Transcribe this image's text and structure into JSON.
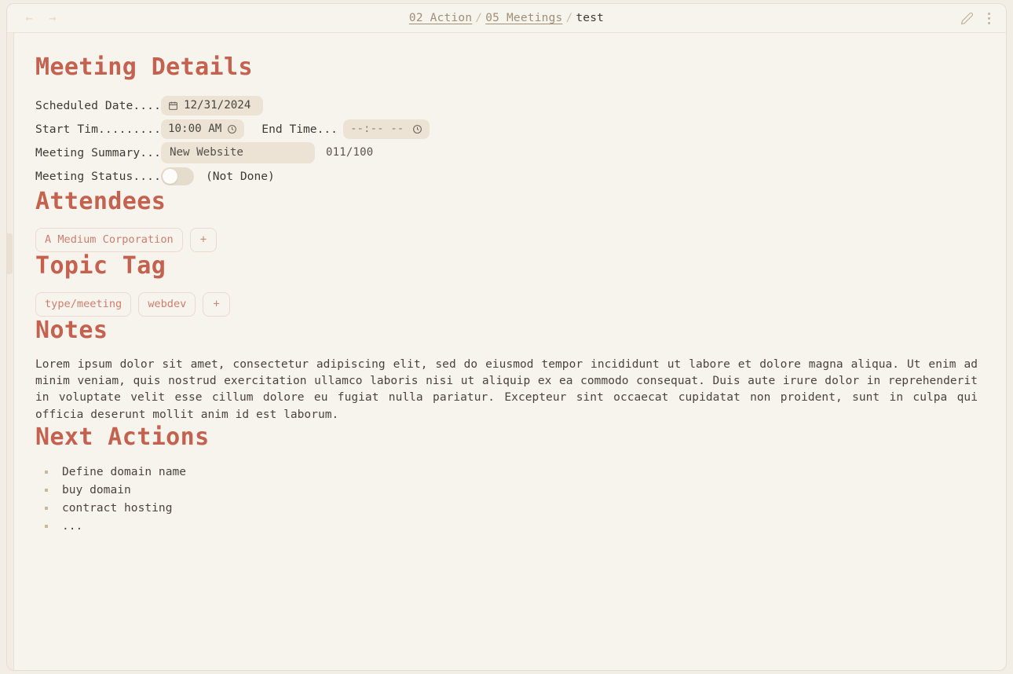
{
  "titlebar": {
    "back_icon": "arrow-left-icon",
    "forward_icon": "arrow-right-icon",
    "back_glyph": "←",
    "forward_glyph": "→",
    "breadcrumb": [
      {
        "label": "02 Action",
        "link": true
      },
      {
        "label": "05 Meetings",
        "link": true
      },
      {
        "label": "test",
        "link": false
      }
    ],
    "separator": "/",
    "edit_icon": "pencil-icon",
    "menu_icon": "kebab-menu-icon"
  },
  "sections": {
    "meeting_details": "Meeting Details",
    "attendees": "Attendees",
    "topic_tag": "Topic Tag",
    "notes": "Notes",
    "next_actions": "Next Actions"
  },
  "details": {
    "scheduled_date": {
      "label": "Scheduled Date....",
      "value": "12/31/2024",
      "icon": "calendar-icon"
    },
    "start_time": {
      "label": "Start Tim.........",
      "value": "10:00 AM",
      "icon": "clock-icon"
    },
    "end_time": {
      "label": "End Time...",
      "value": "--:-- --",
      "icon": "clock-icon"
    },
    "summary": {
      "label": "Meeting Summary...",
      "value": "New Website",
      "counter": "011/100"
    },
    "status": {
      "label": "Meeting Status....",
      "toggle_on": false,
      "note": "(Not Done)"
    }
  },
  "attendees": {
    "items": [
      "A Medium Corporation"
    ],
    "add_label": "+"
  },
  "topic_tags": {
    "items": [
      "type/meeting",
      "webdev"
    ],
    "add_label": "+"
  },
  "notes_body": "Lorem ipsum dolor sit amet, consectetur adipiscing elit, sed do eiusmod tempor incididunt ut labore et dolore magna aliqua. Ut enim ad minim veniam, quis nostrud exercitation ullamco laboris nisi ut aliquip ex ea commodo consequat. Duis aute irure dolor in reprehenderit in voluptate velit esse cillum dolore eu fugiat nulla pariatur. Excepteur sint occaecat cupidatat non proident, sunt in culpa qui officia deserunt mollit anim id est laborum.",
  "next_actions": [
    "Define domain name",
    "buy domain",
    "contract hosting",
    "..."
  ],
  "colors": {
    "heading": "#c4614f",
    "background": "#f7f4ee",
    "field": "#ece3d5",
    "pill_text": "#cf7e6d",
    "pill_border": "#ecd9d2",
    "crumb_link": "#a08f76"
  }
}
